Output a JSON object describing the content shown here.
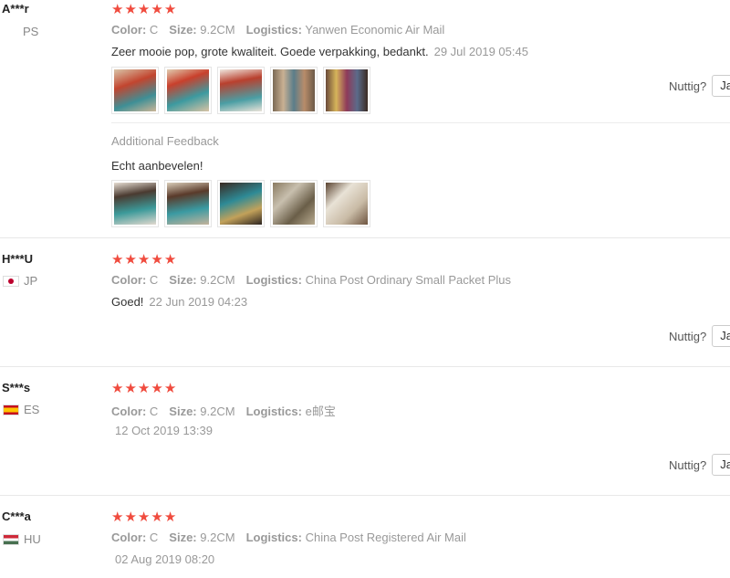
{
  "colors": {
    "star": "#f04b3e",
    "muted": "#999999",
    "divider": "#e8e8e8"
  },
  "reviews": [
    {
      "user": "A***r",
      "country": "PS",
      "flag": "none",
      "stars": 5,
      "color_label": "Color:",
      "color_value": "C",
      "size_label": "Size:",
      "size_value": "9.2CM",
      "logistics_label": "Logistics:",
      "logistics_value": "Yanwen Economic Air Mail",
      "text": "Zeer mooie pop, grote kwaliteit. Goede verpakking, bedankt.",
      "date": "29 Jul 2019 05:45",
      "photos": [
        "doll-photo",
        "doll-photo",
        "doll-photo",
        "dolls-group-photo",
        "dolls-group-photo"
      ],
      "additional_feedback": {
        "label": "Additional Feedback",
        "text": "Echt aanbevelen!",
        "photos": [
          "doll-photo",
          "doll-photo",
          "doll-photo",
          "package-photo",
          "package-photo"
        ]
      },
      "helpful_label": "Nuttig?",
      "helpful_button": "Ja"
    },
    {
      "user": "H***U",
      "country": "JP",
      "flag": "jp-flag-icon",
      "stars": 5,
      "color_label": "Color:",
      "color_value": "C",
      "size_label": "Size:",
      "size_value": "9.2CM",
      "logistics_label": "Logistics:",
      "logistics_value": "China Post Ordinary Small Packet Plus",
      "text": "Goed!",
      "date": "22 Jun 2019 04:23",
      "helpful_label": "Nuttig?",
      "helpful_button": "Ja"
    },
    {
      "user": "S***s",
      "country": "ES",
      "flag": "es-flag-icon",
      "stars": 5,
      "color_label": "Color:",
      "color_value": "C",
      "size_label": "Size:",
      "size_value": "9.2CM",
      "logistics_label": "Logistics:",
      "logistics_value": "e邮宝",
      "date": "12 Oct 2019 13:39",
      "helpful_label": "Nuttig?",
      "helpful_button": "Ja"
    },
    {
      "user": "C***a",
      "country": "HU",
      "flag": "hu-flag-icon",
      "stars": 5,
      "color_label": "Color:",
      "color_value": "C",
      "size_label": "Size:",
      "size_value": "9.2CM",
      "logistics_label": "Logistics:",
      "logistics_value": "China Post Registered Air Mail",
      "date": "02 Aug 2019 08:20"
    }
  ]
}
